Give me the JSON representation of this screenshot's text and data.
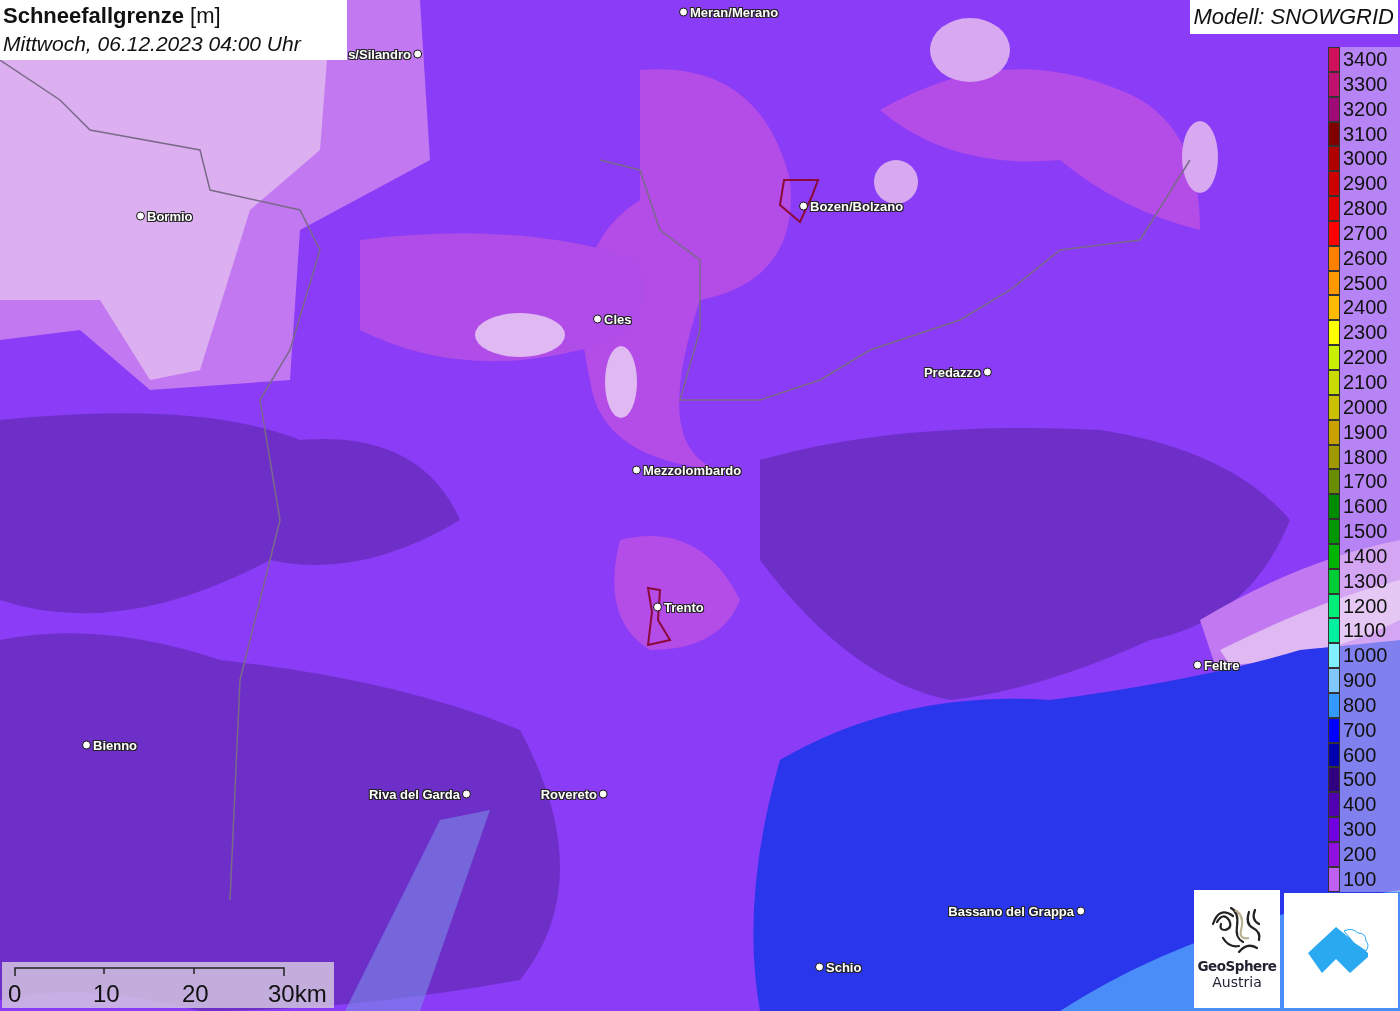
{
  "title": {
    "heading": "**Schneefallgrenze** [m]",
    "time": "Mittwoch, 06.12.2023 04:00 Uhr"
  },
  "model_label": "Modell: SNOWGRID",
  "legend": [
    {
      "label": "3400",
      "color": "#d0105a"
    },
    {
      "label": "3300",
      "color": "#c01070"
    },
    {
      "label": "3200",
      "color": "#a00a78"
    },
    {
      "label": "3100",
      "color": "#800000"
    },
    {
      "label": "3000",
      "color": "#b00000"
    },
    {
      "label": "2900",
      "color": "#cc0000"
    },
    {
      "label": "2800",
      "color": "#e00000"
    },
    {
      "label": "2700",
      "color": "#ff0000"
    },
    {
      "label": "2600",
      "color": "#ff8000"
    },
    {
      "label": "2500",
      "color": "#ff9900"
    },
    {
      "label": "2400",
      "color": "#ffbb00"
    },
    {
      "label": "2300",
      "color": "#ffff00"
    },
    {
      "label": "2200",
      "color": "#c8f000"
    },
    {
      "label": "2100",
      "color": "#c8dc00"
    },
    {
      "label": "2000",
      "color": "#c8c000"
    },
    {
      "label": "1900",
      "color": "#c8a000"
    },
    {
      "label": "1800",
      "color": "#a09a00"
    },
    {
      "label": "1700",
      "color": "#6a8c00"
    },
    {
      "label": "1600",
      "color": "#008c00"
    },
    {
      "label": "1500",
      "color": "#009600"
    },
    {
      "label": "1400",
      "color": "#00b400"
    },
    {
      "label": "1300",
      "color": "#00cc33"
    },
    {
      "label": "1200",
      "color": "#00ee77"
    },
    {
      "label": "1100",
      "color": "#00f0a0"
    },
    {
      "label": "1000",
      "color": "#80f0ff"
    },
    {
      "label": "900",
      "color": "#80c8ff"
    },
    {
      "label": "800",
      "color": "#3399ff"
    },
    {
      "label": "700",
      "color": "#0000ff"
    },
    {
      "label": "600",
      "color": "#0000b0"
    },
    {
      "label": "500",
      "color": "#300080"
    },
    {
      "label": "400",
      "color": "#5000b0"
    },
    {
      "label": "300",
      "color": "#7000e0"
    },
    {
      "label": "200",
      "color": "#9010e0"
    },
    {
      "label": "100",
      "color": "#c060f0"
    }
  ],
  "places": [
    {
      "name": "Meran/Merano"
    },
    {
      "name": "s/Silandro"
    },
    {
      "name": "Bormio"
    },
    {
      "name": "Bozen/Bolzano"
    },
    {
      "name": "Cles"
    },
    {
      "name": "Predazzo"
    },
    {
      "name": "Mezzolombardo"
    },
    {
      "name": "Trento"
    },
    {
      "name": "Feltre"
    },
    {
      "name": "Bienno"
    },
    {
      "name": "Riva del Garda"
    },
    {
      "name": "Rovereto"
    },
    {
      "name": "Bassano del Grappa"
    },
    {
      "name": "Schio"
    }
  ],
  "scale_bar": {
    "ticks": [
      "0",
      "10",
      "20",
      "30km"
    ]
  },
  "logo": {
    "line1": "GeoSphere",
    "line2": "Austria"
  }
}
